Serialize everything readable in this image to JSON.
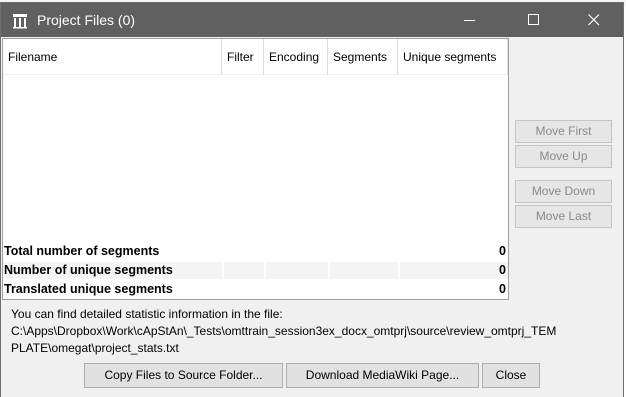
{
  "window": {
    "title": "Project Files (0)"
  },
  "table": {
    "columns": [
      "Filename",
      "Filter",
      "Encoding",
      "Segments",
      "Unique segments"
    ],
    "rows": []
  },
  "totals": [
    {
      "label": "Total number of segments",
      "value": "0"
    },
    {
      "label": "Number of unique segments",
      "value": "0"
    },
    {
      "label": "Translated unique segments",
      "value": "0"
    }
  ],
  "side_buttons": {
    "move_first": "Move First",
    "move_up": "Move Up",
    "move_down": "Move Down",
    "move_last": "Move Last"
  },
  "info": {
    "line1": "You can find detailed statistic information in the file:",
    "line2": "C:\\Apps\\Dropbox\\Work\\cApStAn\\_Tests\\omttrain_session3ex_docx_omtprj\\source\\review_omtprj_TEM",
    "line3": "PLATE\\omegat\\project_stats.txt"
  },
  "buttons": {
    "copy_files": "Copy Files to Source Folder...",
    "download_mediawiki": "Download MediaWiki Page...",
    "close": "Close"
  }
}
